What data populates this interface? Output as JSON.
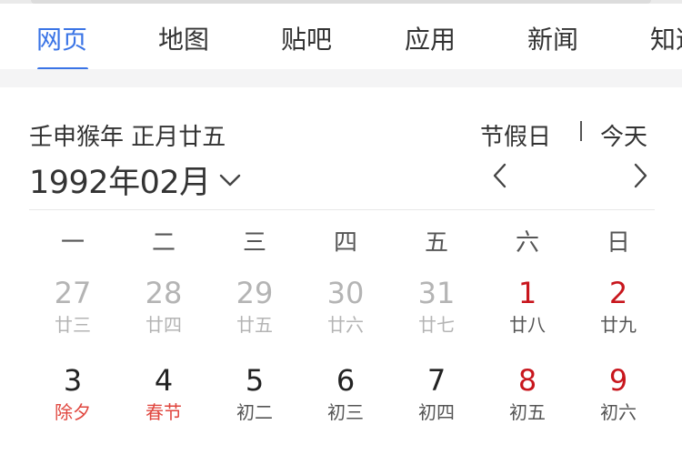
{
  "tabs": [
    {
      "label": "网页",
      "active": true
    },
    {
      "label": "地图",
      "active": false
    },
    {
      "label": "贴吧",
      "active": false
    },
    {
      "label": "应用",
      "active": false
    },
    {
      "label": "新闻",
      "active": false
    },
    {
      "label": "知道",
      "active": false
    }
  ],
  "calendar": {
    "lunar_date": "壬申猴年  正月廿五",
    "month_label": "1992年02月",
    "holidays_label": "节假日",
    "today_label": "今天",
    "weekdays": [
      "一",
      "二",
      "三",
      "四",
      "五",
      "六",
      "日"
    ],
    "rows": [
      [
        {
          "day": "27",
          "lunar": "廿三",
          "muted": true
        },
        {
          "day": "28",
          "lunar": "廿四",
          "muted": true
        },
        {
          "day": "29",
          "lunar": "廿五",
          "muted": true
        },
        {
          "day": "30",
          "lunar": "廿六",
          "muted": true
        },
        {
          "day": "31",
          "lunar": "廿七",
          "muted": true
        },
        {
          "day": "1",
          "lunar": "廿八",
          "weekend": true
        },
        {
          "day": "2",
          "lunar": "廿九",
          "weekend": true
        }
      ],
      [
        {
          "day": "3",
          "lunar": "除夕",
          "festival": true
        },
        {
          "day": "4",
          "lunar": "春节",
          "festival": true
        },
        {
          "day": "5",
          "lunar": "初二"
        },
        {
          "day": "6",
          "lunar": "初三"
        },
        {
          "day": "7",
          "lunar": "初四"
        },
        {
          "day": "8",
          "lunar": "初五",
          "weekend": true
        },
        {
          "day": "9",
          "lunar": "初六",
          "weekend": true
        }
      ]
    ]
  },
  "colors": {
    "accent": "#3a74e6",
    "weekend_red": "#c8161d",
    "festival_red": "#e0463e",
    "muted_gray": "#b4b4b4"
  },
  "icons": {
    "month_dropdown": "chevron-down-icon",
    "prev": "chevron-left-icon",
    "next": "chevron-right-icon"
  }
}
